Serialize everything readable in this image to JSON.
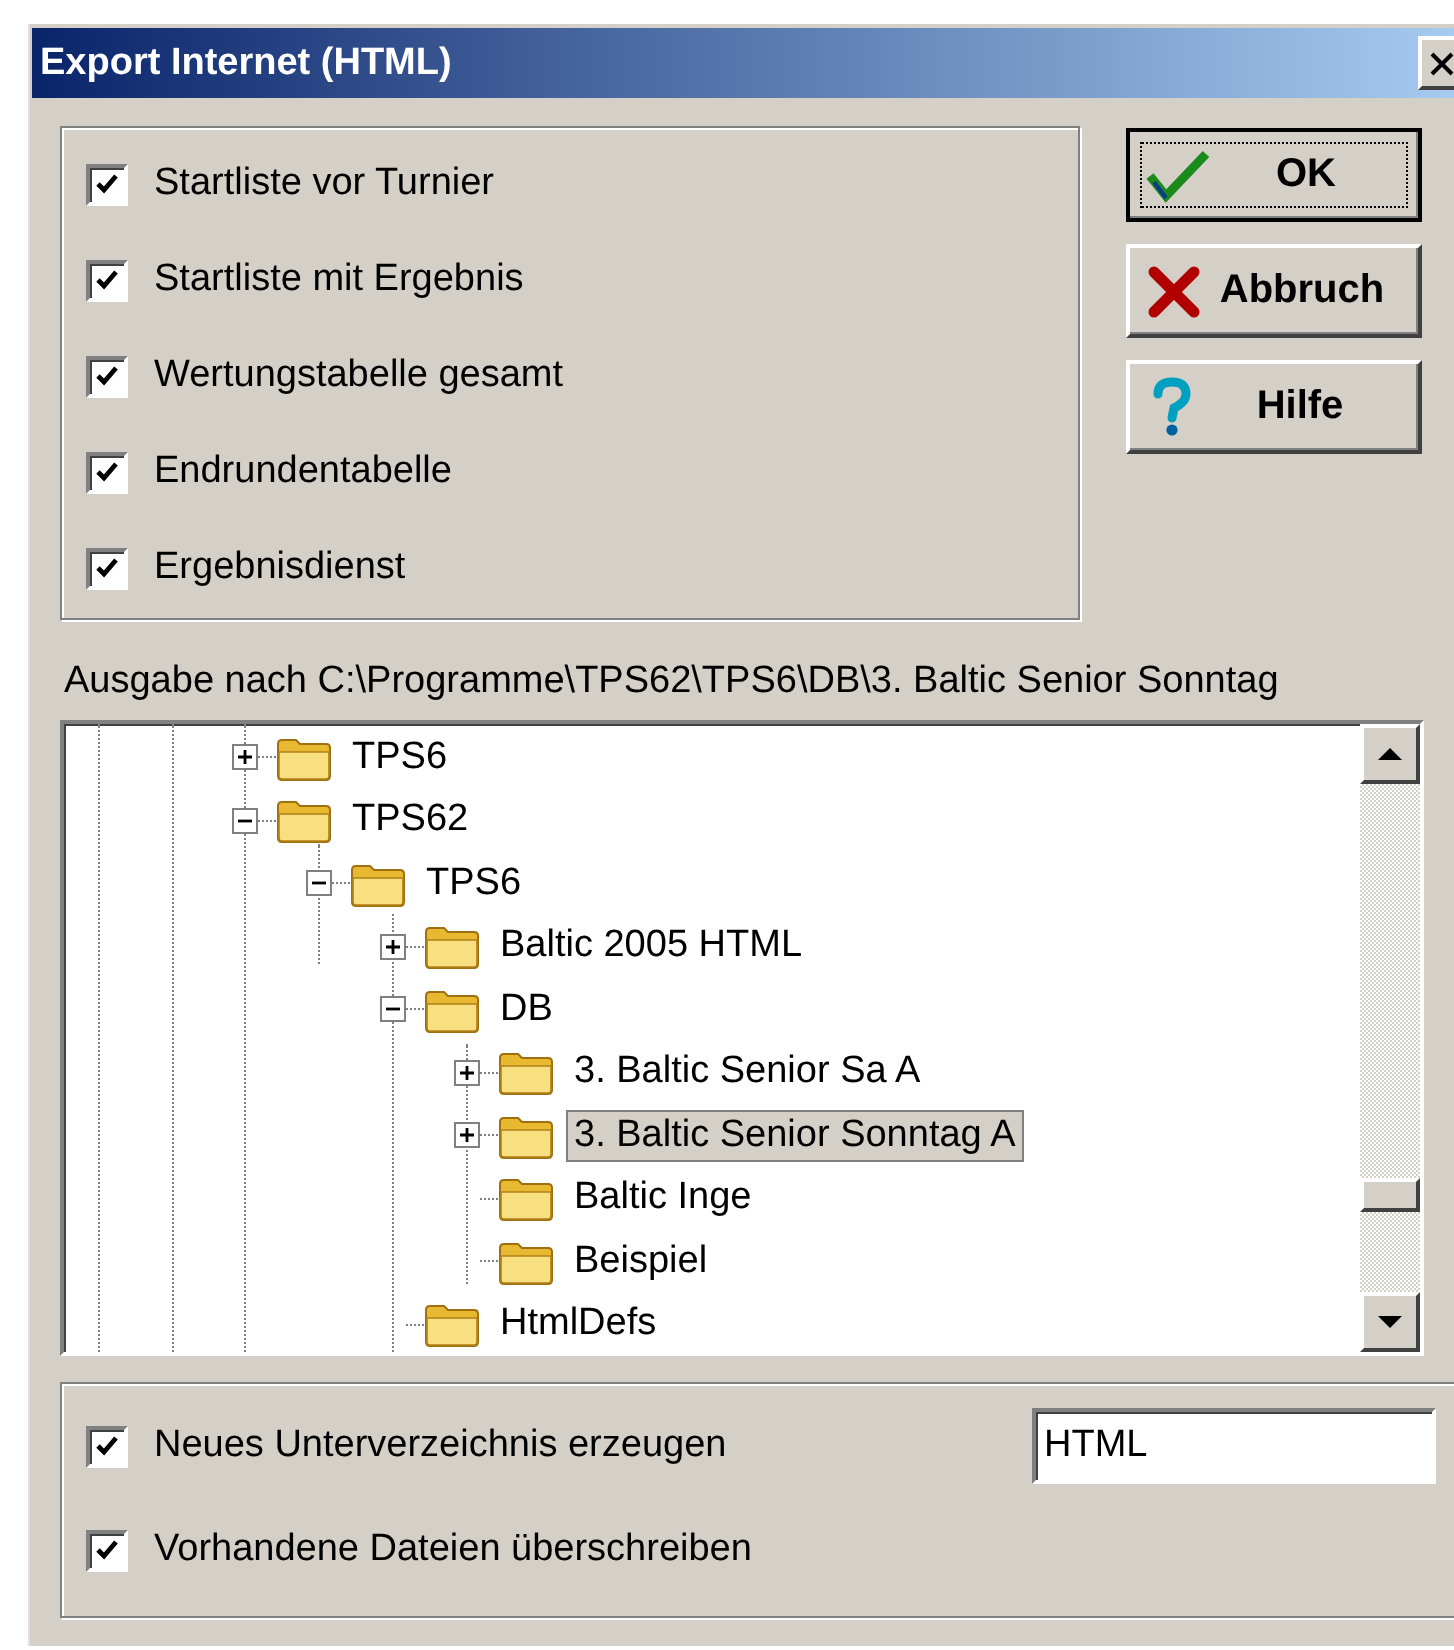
{
  "window": {
    "title": "Export Internet (HTML)"
  },
  "options": [
    {
      "label": "Startliste vor Turnier",
      "checked": true
    },
    {
      "label": "Startliste mit Ergebnis",
      "checked": true
    },
    {
      "label": "Wertungstabelle gesamt",
      "checked": true
    },
    {
      "label": "Endrundentabelle",
      "checked": true
    },
    {
      "label": "Ergebnisdienst",
      "checked": true
    }
  ],
  "buttons": [
    {
      "label": "OK",
      "kind": "ok",
      "default": true
    },
    {
      "label": "Abbruch",
      "kind": "cancel",
      "default": false
    },
    {
      "label": "Hilfe",
      "kind": "help",
      "default": false
    }
  ],
  "output_path": "Ausgabe nach C:\\Programme\\TPS62\\TPS6\\DB\\3. Baltic Senior Sonntag",
  "tree": [
    {
      "label": "TPS6",
      "expanded": false,
      "selected": false
    },
    {
      "label": "TPS62",
      "expanded": true,
      "selected": false,
      "children": [
        {
          "label": "TPS6",
          "expanded": true,
          "selected": false,
          "children": [
            {
              "label": "Baltic 2005 HTML",
              "expanded": false,
              "selected": false
            },
            {
              "label": "DB",
              "expanded": true,
              "selected": false,
              "children": [
                {
                  "label": "3. Baltic Senior Sa A",
                  "expanded": false,
                  "selected": false
                },
                {
                  "label": "3. Baltic Senior Sonntag A",
                  "expanded": false,
                  "selected": true
                },
                {
                  "label": "Baltic Inge",
                  "selected": false
                },
                {
                  "label": "Beispiel",
                  "selected": false
                }
              ]
            },
            {
              "label": "HtmlDefs",
              "selected": false
            }
          ]
        }
      ]
    }
  ],
  "bottom_options": [
    {
      "label": "Neues Unterverzeichnis erzeugen",
      "checked": true,
      "field_value": "HTML"
    },
    {
      "label": "Vorhandene Dateien überschreiben",
      "checked": true
    }
  ]
}
